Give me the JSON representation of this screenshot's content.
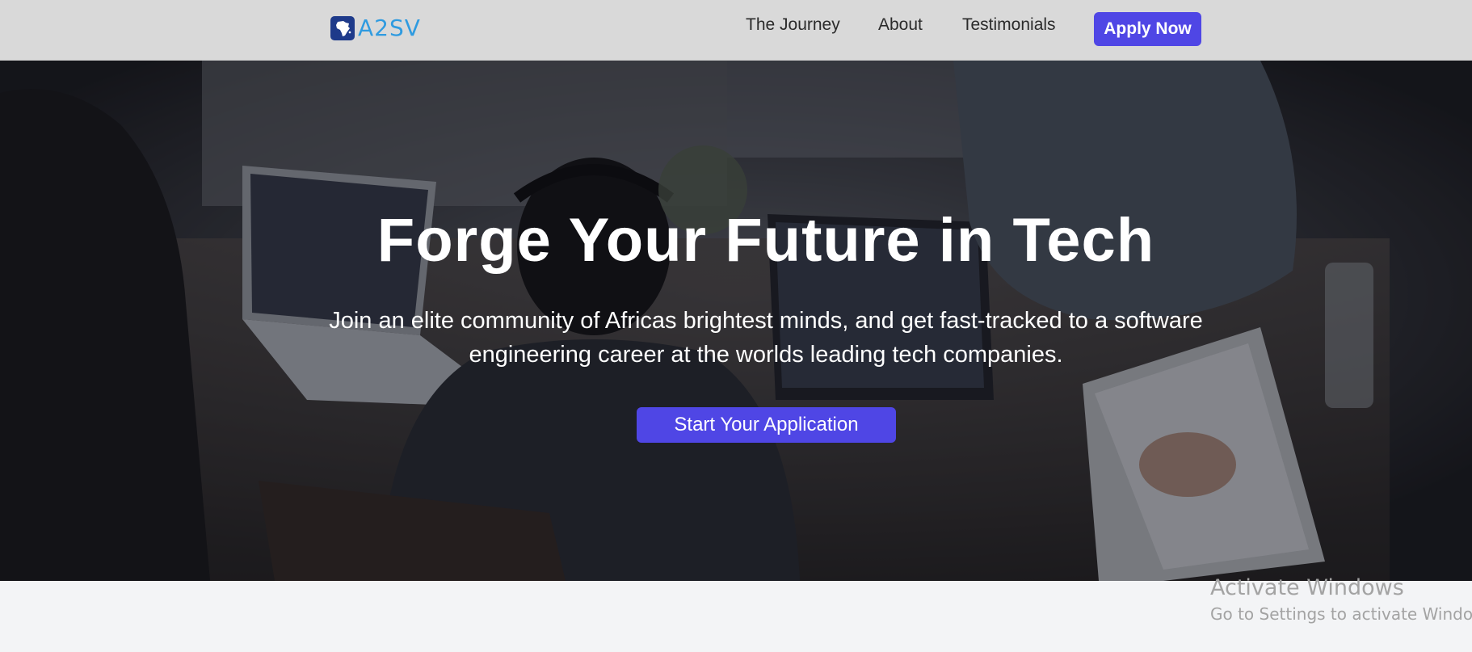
{
  "navbar": {
    "logo_text": "A2SV",
    "links": [
      {
        "label": "The Journey"
      },
      {
        "label": "About"
      },
      {
        "label": "Testimonials"
      }
    ],
    "apply_label": "Apply Now"
  },
  "hero": {
    "title": "Forge Your Future in Tech",
    "subtitle": "Join an elite community of Africas brightest minds, and get fast-tracked to a software engineering career at the worlds leading tech companies.",
    "cta_label": "Start Your Application"
  },
  "watermark": {
    "title": "Activate Windows",
    "subtitle": "Go to Settings to activate Windows."
  },
  "colors": {
    "accent": "#4f46e5",
    "navbar_bg": "#d9d9d9",
    "logo_blue": "#2f9be0",
    "page_bg": "#f3f4f6"
  },
  "icons": {
    "logo": "africa-map-icon"
  }
}
